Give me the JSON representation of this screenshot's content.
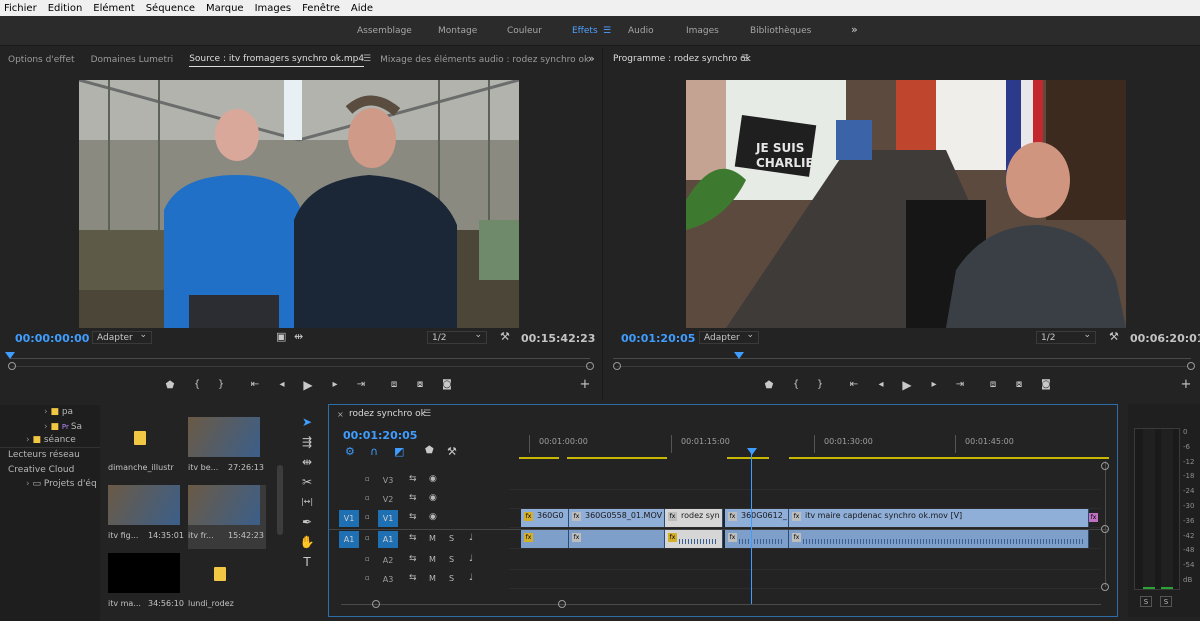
{
  "menu": [
    "Fichier",
    "Edition",
    "Elément",
    "Séquence",
    "Marque",
    "Images",
    "Fenêtre",
    "Aide"
  ],
  "workspaces": [
    {
      "label": "Assemblage",
      "active": false
    },
    {
      "label": "Montage",
      "active": false
    },
    {
      "label": "Couleur",
      "active": false
    },
    {
      "label": "Effets",
      "active": true
    },
    {
      "label": "Audio",
      "active": false
    },
    {
      "label": "Images",
      "active": false
    },
    {
      "label": "Bibliothèques",
      "active": false
    }
  ],
  "workspace_overflow": "»",
  "workspace_menu_icon": "hamburger-icon",
  "source_panel": {
    "tabs": [
      "Options d'effet",
      "Domaines Lumetri",
      "Source : itv fromagers synchro ok.mp4",
      "Mixage des éléments audio : rodez synchro ok"
    ],
    "selected_tab": 2,
    "overflow": "»",
    "timecode_current": "00:00:00:00",
    "fit": "Adapter",
    "resolution": "1/2",
    "timecode_duration": "00:15:42:23",
    "playhead_fraction": 0.0
  },
  "program_panel": {
    "tab": "Programme : rodez synchro ok",
    "timecode_current": "00:01:20:05",
    "fit": "Adapter",
    "resolution": "1/2",
    "timecode_duration": "00:06:20:01",
    "playhead_fraction": 0.21,
    "frame_text": [
      "JE SUIS",
      "CHARLIE"
    ]
  },
  "project_panel": {
    "tree": [
      {
        "label": "pa",
        "indent": 2
      },
      {
        "label": "Sa",
        "indent": 2,
        "badge": "Pr"
      },
      {
        "label": "séance",
        "indent": 1
      },
      {
        "label": "Lecteurs réseau",
        "indent": 0
      },
      {
        "label": "Creative Cloud",
        "indent": 0
      },
      {
        "label": "Projets d'éq",
        "indent": 1
      }
    ],
    "items": [
      {
        "name": "dimanche_illustr",
        "duration": "",
        "kind": "folder"
      },
      {
        "name": "itv be...",
        "duration": "27:26:13",
        "kind": "video"
      },
      {
        "name": "itv fig...",
        "duration": "14:35:01",
        "kind": "video"
      },
      {
        "name": "itv fr...",
        "duration": "15:42:23",
        "kind": "video",
        "selected": true
      },
      {
        "name": "itv ma...",
        "duration": "34:56:10",
        "kind": "black"
      },
      {
        "name": "lundi_rodez",
        "duration": "",
        "kind": "folder"
      }
    ]
  },
  "tools": [
    "selection-tool",
    "track-select-tool",
    "ripple-edit-tool",
    "razor-tool",
    "slip-tool",
    "pen-tool",
    "hand-tool",
    "type-tool"
  ],
  "timeline": {
    "tab": "rodez synchro ok",
    "timecode": "00:01:20:05",
    "ruler_labels": [
      "00:01:00:00",
      "00:01:15:00",
      "00:01:30:00",
      "00:01:45:00"
    ],
    "tracks": [
      {
        "target": "",
        "label": "V3",
        "type": "video"
      },
      {
        "target": "",
        "label": "V2",
        "type": "video"
      },
      {
        "target": "V1",
        "label": "V1",
        "type": "video"
      },
      {
        "target": "A1",
        "label": "A1",
        "type": "audio"
      },
      {
        "target": "",
        "label": "A2",
        "type": "audio"
      },
      {
        "target": "",
        "label": "A3",
        "type": "audio"
      }
    ],
    "audio_buttons": [
      "M",
      "S"
    ],
    "video_clips": [
      {
        "label": "360G0",
        "selected": false
      },
      {
        "label": "360G0558_01.MOV [",
        "selected": false
      },
      {
        "label": "rodez syn",
        "selected": true
      },
      {
        "label": "360G0612_",
        "selected": false
      },
      {
        "label": "itv maire capdenac synchro ok.mov [V]",
        "selected": false
      }
    ]
  },
  "meters": {
    "scale": [
      "0",
      "-6",
      "-12",
      "-18",
      "-24",
      "-30",
      "-36",
      "-42",
      "-48",
      "-54",
      "dB"
    ],
    "solo_labels": [
      "S",
      "S"
    ]
  }
}
